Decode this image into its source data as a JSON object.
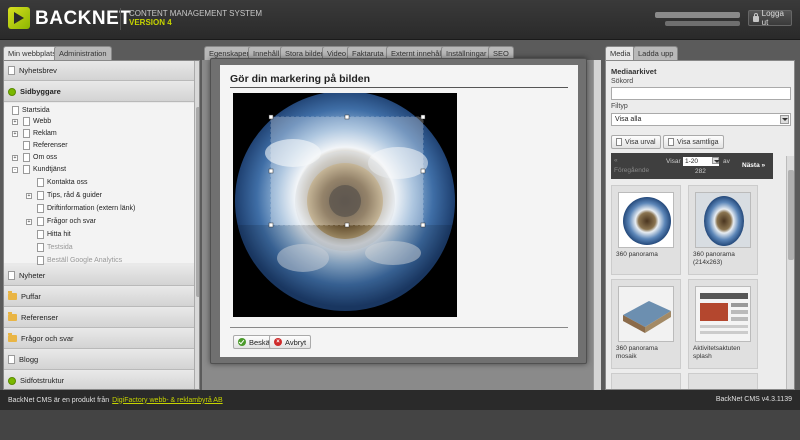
{
  "header": {
    "logo": "BACKNET",
    "cms_label": "CONTENT MANAGEMENT SYSTEM",
    "version_label": "VERSION 4",
    "logout": "Logga ut"
  },
  "left": {
    "tabs": [
      "Min webbplats",
      "Administration"
    ],
    "sections_top": [
      {
        "label": "Nyhetsbrev",
        "icon": "page-icon"
      },
      {
        "label": "Sidbyggare",
        "icon": "green-dot-icon"
      }
    ],
    "tree": [
      {
        "label": "Startsida",
        "indent": 0,
        "expander": ""
      },
      {
        "label": "Webb",
        "indent": 1,
        "expander": "+"
      },
      {
        "label": "Reklam",
        "indent": 1,
        "expander": "+"
      },
      {
        "label": "Referenser",
        "indent": 1,
        "expander": ""
      },
      {
        "label": "Om oss",
        "indent": 1,
        "expander": "+"
      },
      {
        "label": "Kundtjänst",
        "indent": 1,
        "expander": "-"
      },
      {
        "label": "Kontakta oss",
        "indent": 2,
        "expander": ""
      },
      {
        "label": "Tips, råd & guider",
        "indent": 2,
        "expander": "+"
      },
      {
        "label": "Driftinformation (extern länk)",
        "indent": 2,
        "expander": ""
      },
      {
        "label": "Frågor och svar",
        "indent": 2,
        "expander": "+"
      },
      {
        "label": "Hitta hit",
        "indent": 2,
        "expander": ""
      },
      {
        "label": "Testsida",
        "indent": 2,
        "expander": "",
        "grey": true
      },
      {
        "label": "Beställ Google Analytics",
        "indent": 2,
        "expander": "",
        "grey": true
      }
    ],
    "sections_bottom": [
      {
        "label": "Nyheter",
        "icon": "page-icon"
      },
      {
        "label": "Puffar",
        "icon": "folder-icon"
      },
      {
        "label": "Referenser",
        "icon": "folder-icon"
      },
      {
        "label": "Frågor och svar",
        "icon": "folder-icon"
      },
      {
        "label": "Blogg",
        "icon": "page-icon"
      },
      {
        "label": "Sidfotstruktur",
        "icon": "green-dot-icon"
      }
    ]
  },
  "center": {
    "tabs": [
      "Egenskaper",
      "Innehåll",
      "Stora bilder",
      "Video",
      "Faktaruta",
      "Externt innehåll",
      "Inställningar",
      "SEO"
    ]
  },
  "modal": {
    "title": "Gör din markering på bilden",
    "ok": "Beskär",
    "cancel": "Avbryt"
  },
  "right": {
    "tabs": [
      "Media",
      "Ladda upp"
    ],
    "title": "Mediaarkivet",
    "search_label": "Sökord",
    "filetype_label": "Filtyp",
    "filetype_value": "Visa alla",
    "btn_selected": "Visa urval",
    "btn_all": "Visa samtliga",
    "pager": {
      "prev": "Föregående",
      "show": "Visar",
      "range": "1-20",
      "of": "av",
      "total": "282",
      "next": "Nästa »"
    },
    "items": [
      {
        "caption": "360 panorama"
      },
      {
        "caption": "360 panorama (214x263)"
      },
      {
        "caption": "360 panorama mosaik"
      },
      {
        "caption": "Aktivitetsaktuten splash"
      }
    ]
  },
  "footer": {
    "text": "BackNet CMS är en produkt från",
    "link": "DigiFactory webb- & reklambyrå AB",
    "version": "BackNet CMS v4.3.1139"
  }
}
